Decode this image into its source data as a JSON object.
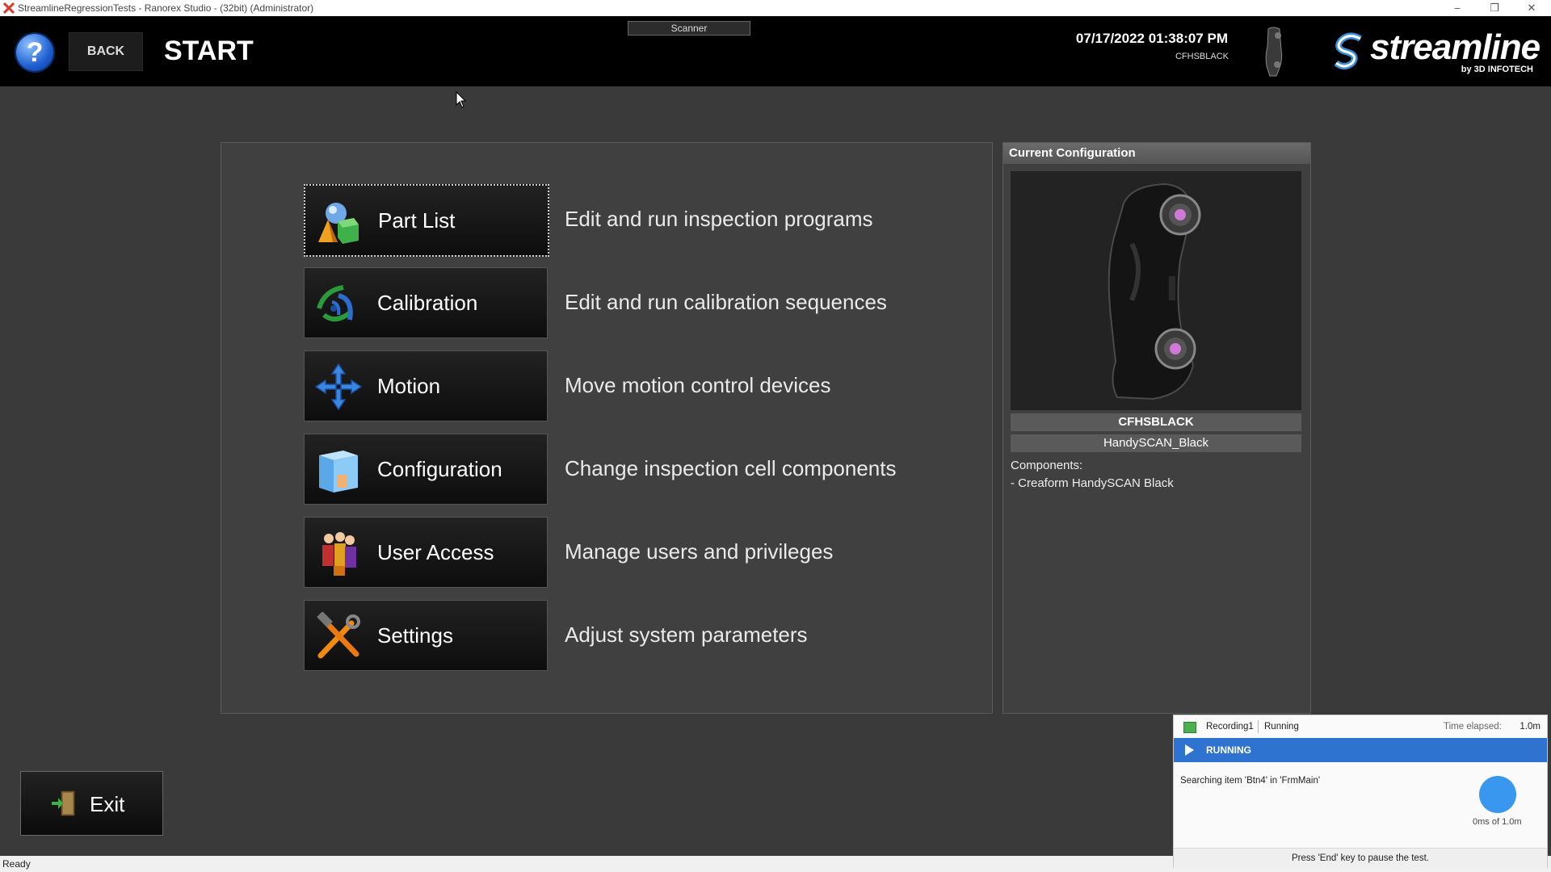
{
  "window": {
    "title": "StreamlineRegressionTests - Ranorex Studio - (32bit) (Administrator)",
    "controls": [
      "–",
      "❐",
      "✕"
    ]
  },
  "header": {
    "help_label": "?",
    "back_label": "BACK",
    "page_title": "START",
    "scanner_label": "Scanner",
    "datetime": "07/17/2022 01:38:07 PM",
    "device_id": "CFHSBLACK",
    "logo_word": "streamline",
    "logo_by": "by 3D INFOTECH"
  },
  "menu": [
    {
      "label": "Part List",
      "desc": "Edit and run inspection programs",
      "icon": "part-list-icon"
    },
    {
      "label": "Calibration",
      "desc": "Edit and run calibration sequences",
      "icon": "calibration-icon"
    },
    {
      "label": "Motion",
      "desc": "Move motion control devices",
      "icon": "motion-arrows-icon"
    },
    {
      "label": "Configuration",
      "desc": "Change inspection cell components",
      "icon": "configuration-cube-icon"
    },
    {
      "label": "User Access",
      "desc": "Manage users and privileges",
      "icon": "users-icon"
    },
    {
      "label": "Settings",
      "desc": "Adjust system parameters",
      "icon": "tools-icon"
    }
  ],
  "config": {
    "header": "Current Configuration",
    "name": "CFHSBLACK",
    "model": "HandySCAN_Black",
    "components_title": "Components:",
    "components": [
      "- Creaform HandySCAN Black"
    ]
  },
  "exit_label": "Exit",
  "status_text": "Ready",
  "ranorex": {
    "recording": "Recording1",
    "state": "Running",
    "elapsed_label": "Time elapsed:",
    "elapsed": "1.0m",
    "running_label": "RUNNING",
    "message": "Searching item 'Btn4' in 'FrmMain'",
    "timer": "0ms of 1.0m",
    "footer": "Press 'End' key to pause the test."
  },
  "colors": {
    "accent_blue": "#2f73d0",
    "header_bg": "#000000",
    "panel_bg": "#404040"
  }
}
